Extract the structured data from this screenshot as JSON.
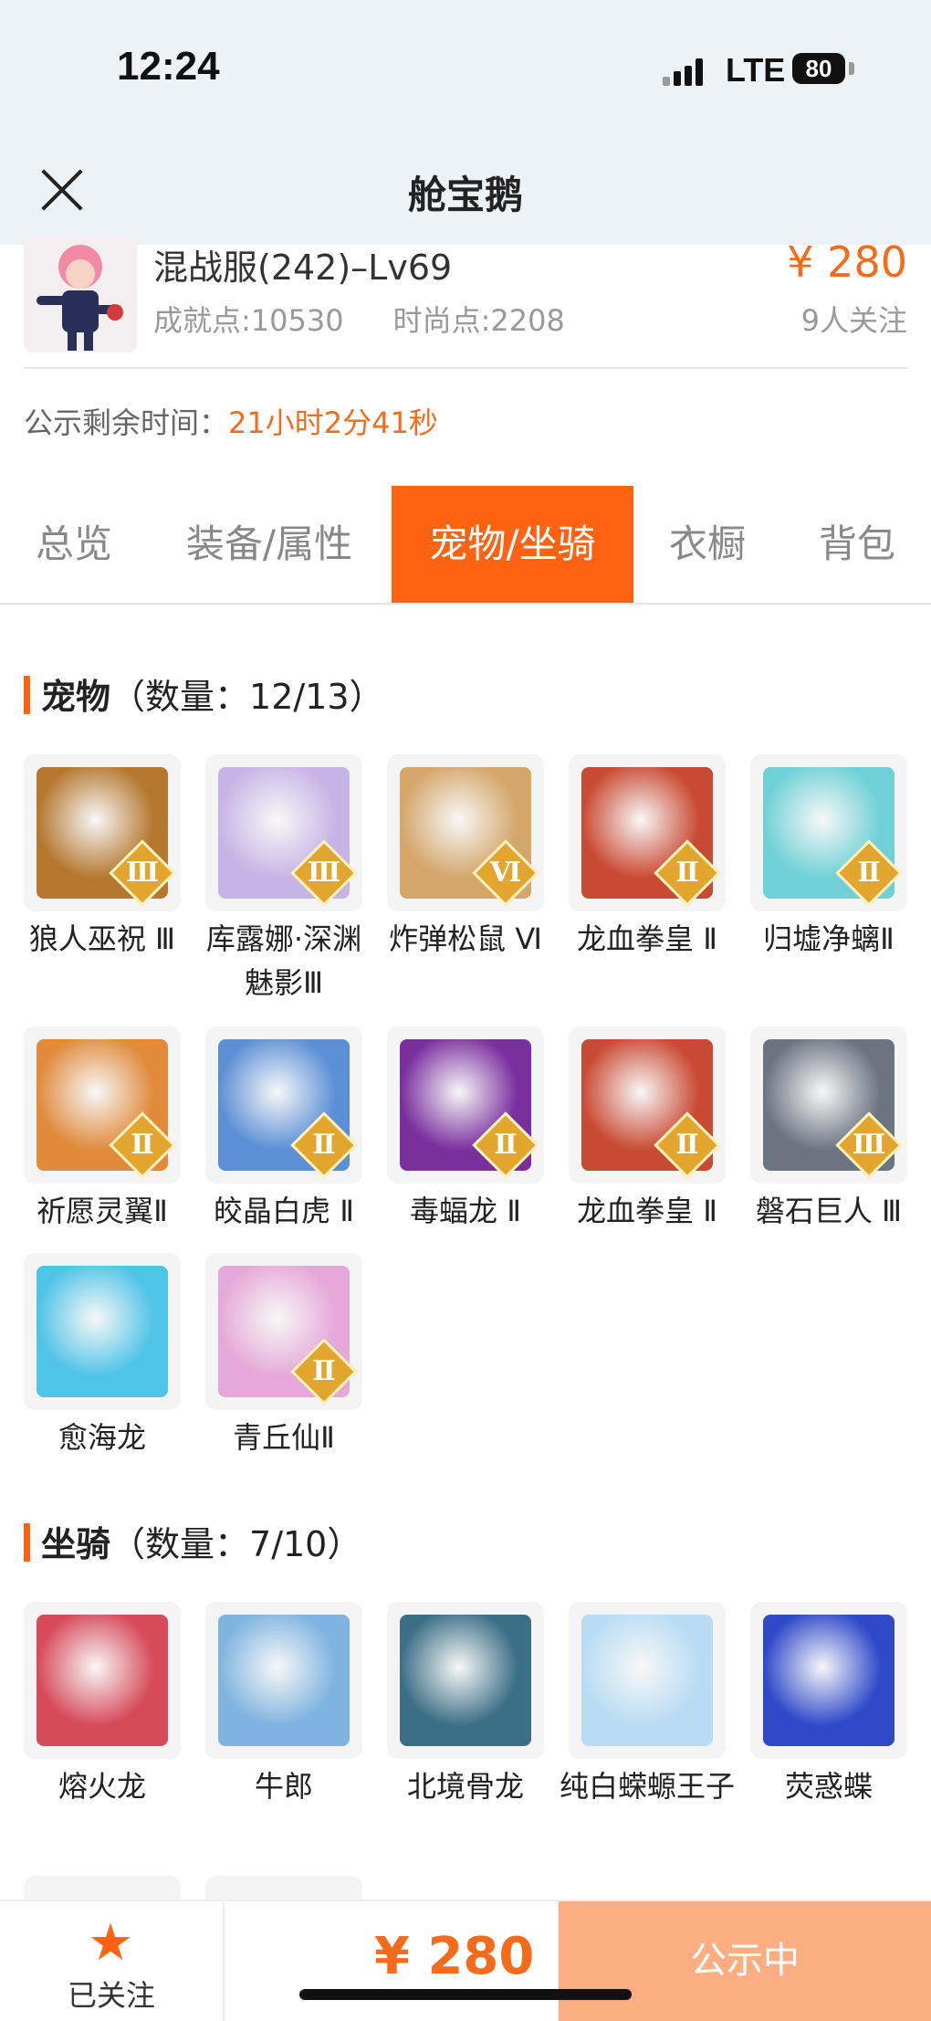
{
  "status_bar": {
    "time": "12:24",
    "network": "LTE",
    "battery": "80"
  },
  "nav": {
    "title": "舱宝鹅"
  },
  "header": {
    "server_level": "混战服(242)–Lv69",
    "achievement": "成就点:10530",
    "fashion": "时尚点:2208",
    "price": "¥ 280",
    "followers": "9人关注"
  },
  "countdown": {
    "label": "公示剩余时间：",
    "value": "21小时2分41秒"
  },
  "tabs": [
    {
      "label": "总览"
    },
    {
      "label": "装备/属性"
    },
    {
      "label": "宠物/坐骑"
    },
    {
      "label": "衣橱"
    },
    {
      "label": "背包"
    }
  ],
  "pets": {
    "title": "宠物",
    "count": "（数量：12/13）",
    "items": [
      {
        "name": "狼人巫祝 Ⅲ",
        "tier": "Ⅲ",
        "color": "#b5772e"
      },
      {
        "name": "库露娜·深渊魅影Ⅲ",
        "tier": "Ⅲ",
        "color": "#c7b4e6"
      },
      {
        "name": "炸弹松鼠 Ⅵ",
        "tier": "Ⅵ",
        "color": "#d4a66a"
      },
      {
        "name": "龙血拳皇 Ⅱ",
        "tier": "Ⅱ",
        "color": "#c94a33"
      },
      {
        "name": "归墟净螭Ⅱ",
        "tier": "Ⅱ",
        "color": "#6fd1d6"
      },
      {
        "name": "祈愿灵翼Ⅱ",
        "tier": "Ⅱ",
        "color": "#e08a3a"
      },
      {
        "name": "皎晶白虎 Ⅱ",
        "tier": "Ⅱ",
        "color": "#5b8fd6"
      },
      {
        "name": "毒蝠龙 Ⅱ",
        "tier": "Ⅱ",
        "color": "#7a2f9e"
      },
      {
        "name": "龙血拳皇 Ⅱ",
        "tier": "Ⅱ",
        "color": "#c94a33"
      },
      {
        "name": "磐石巨人 Ⅲ",
        "tier": "Ⅲ",
        "color": "#6b7480"
      },
      {
        "name": "愈海龙",
        "tier": "",
        "color": "#4fc3e8"
      },
      {
        "name": "青丘仙Ⅱ",
        "tier": "Ⅱ",
        "color": "#e6a8d8"
      }
    ]
  },
  "mounts": {
    "title": "坐骑",
    "count": "（数量：7/10）",
    "items": [
      {
        "name": "熔火龙",
        "color": "#d64a5a"
      },
      {
        "name": "牛郎",
        "color": "#7fb3e0"
      },
      {
        "name": "北境骨龙",
        "color": "#3c6f86"
      },
      {
        "name": "纯白蝾螈王子",
        "color": "#b9dcf4"
      },
      {
        "name": "荧惑蝶",
        "color": "#2f49c9"
      }
    ]
  },
  "bottom_bar": {
    "follow_label": "已关注",
    "price": "¥ 280",
    "status_label": "公示中"
  },
  "colors": {
    "accent": "#ff6210",
    "price": "#f36b1b",
    "status_button": "#fcae82"
  }
}
